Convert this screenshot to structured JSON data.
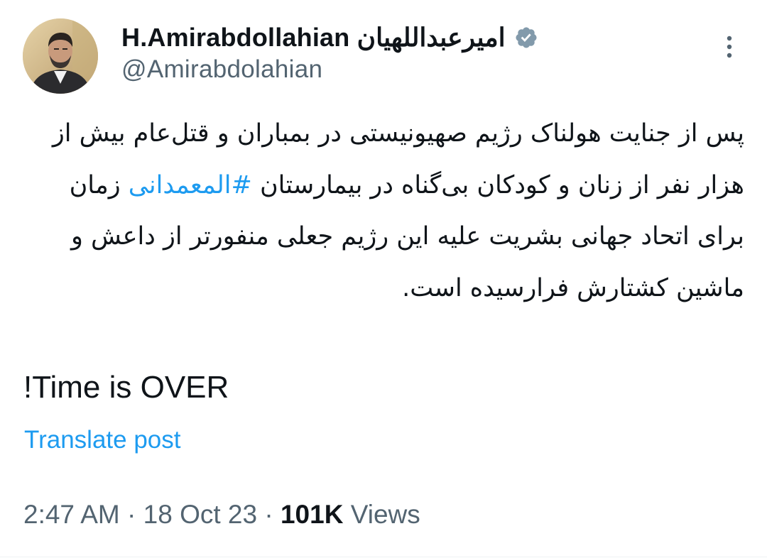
{
  "author": {
    "display_name": "H.Amirabdollahian امیرعبداللهیان",
    "handle": "@Amirabdolahian",
    "avatar_icon": "profile-photo",
    "verified_icon": "verified-badge-icon",
    "verified_color": "#829aab"
  },
  "more_icon": "vertical-ellipsis-icon",
  "post": {
    "text_before_hashtag": "پس از جنایت هولناک رژیم صهیونیستی در بمباران و قتل‌عام بیش از هزار نفر از زنان و کودکان بی‌گناه در بیمارستان ",
    "hashtag": "#المعمدانی",
    "text_after_hashtag": " زمان برای اتحاد جهانی بشریت علیه این رژیم جعلی منفورتر از داعش و ماشین کشتارش فرارسیده است.",
    "tagline": "Time is OVER!"
  },
  "translate_label": "Translate post",
  "meta": {
    "time": "2:47 AM",
    "separator": "·",
    "date": "18 Oct 23",
    "views_count": "101K",
    "views_label": "Views"
  },
  "colors": {
    "link": "#1d9bf0",
    "secondary_text": "#536471",
    "primary_text": "#0f1419"
  }
}
